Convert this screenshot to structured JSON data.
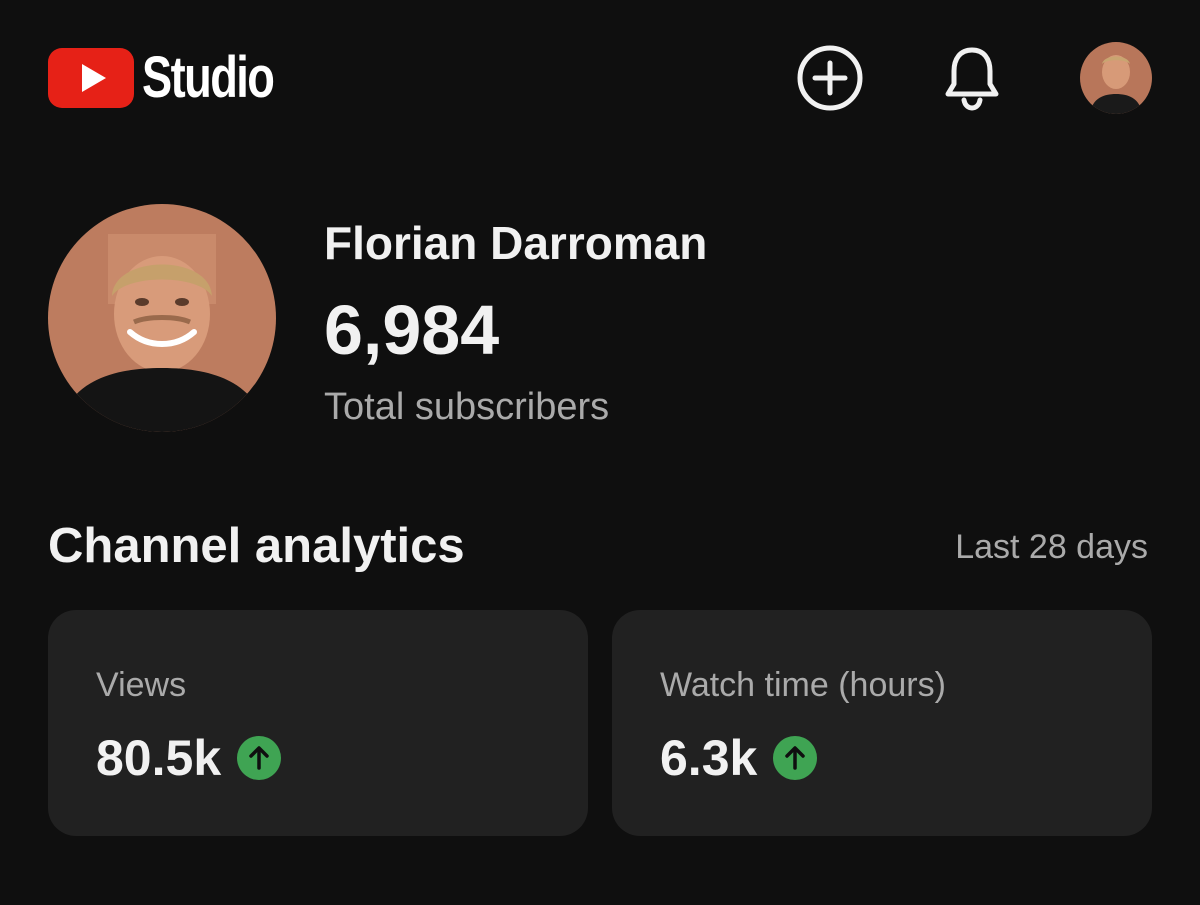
{
  "header": {
    "logo_text": "Studio",
    "logo_icon": "youtube-play-icon",
    "create_icon": "plus-circle-icon",
    "notifications_icon": "bell-icon",
    "brand_color": "#e62117"
  },
  "channel": {
    "name": "Florian Darroman",
    "subscriber_count": "6,984",
    "subscriber_label": "Total subscribers"
  },
  "analytics": {
    "title": "Channel analytics",
    "period": "Last 28 days",
    "cards": [
      {
        "label": "Views",
        "value": "80.5k",
        "trend": "up"
      },
      {
        "label": "Watch time (hours)",
        "value": "6.3k",
        "trend": "up"
      }
    ],
    "trend_color": "#3fa453"
  }
}
